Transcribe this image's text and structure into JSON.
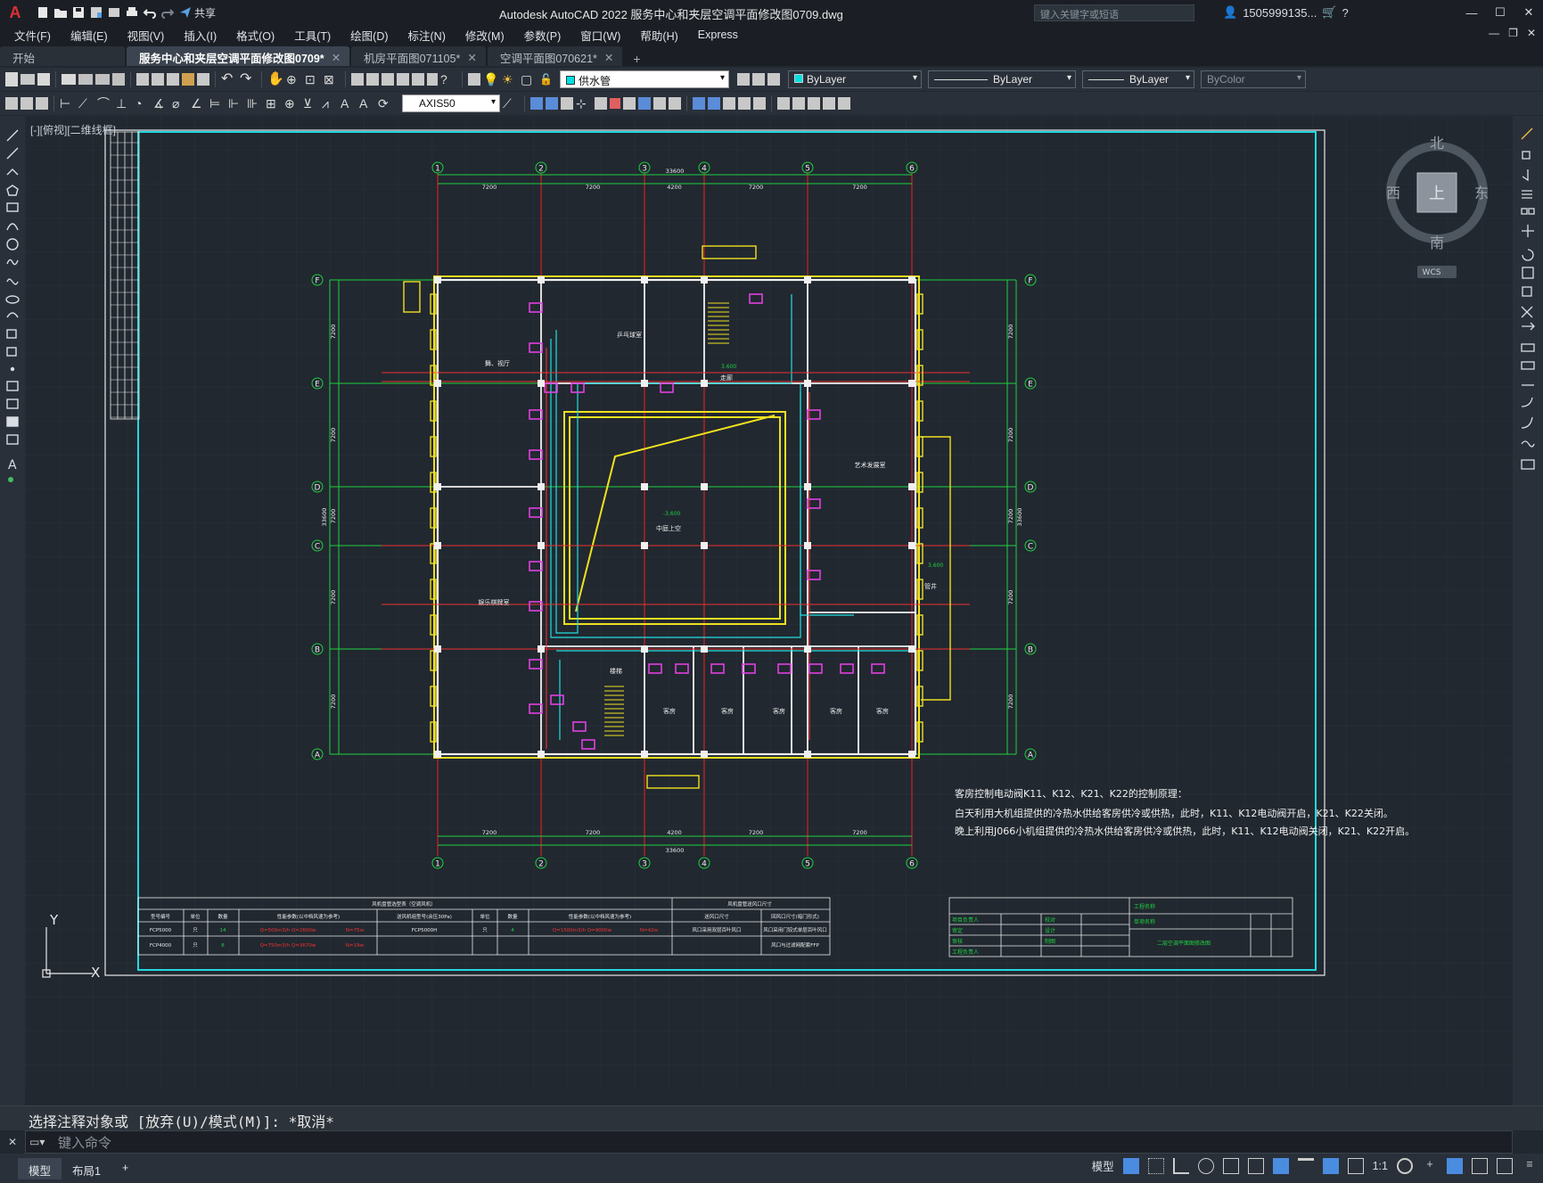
{
  "app": {
    "logo": "A",
    "title": "Autodesk AutoCAD 2022    服务中心和夹层空调平面修改图0709.dwg",
    "share": "共享",
    "search_placeholder": "键入关键字或短语",
    "user": "1505999135...",
    "window_controls": [
      "—",
      "☐",
      "✕"
    ]
  },
  "menu": [
    "文件(F)",
    "编辑(E)",
    "视图(V)",
    "插入(I)",
    "格式(O)",
    "工具(T)",
    "绘图(D)",
    "标注(N)",
    "修改(M)",
    "参数(P)",
    "窗口(W)",
    "帮助(H)",
    "Express"
  ],
  "mdi_controls": [
    "—",
    "❐",
    "✕"
  ],
  "tabs": [
    {
      "label": "开始",
      "active": false,
      "close": ""
    },
    {
      "label": "服务中心和夹层空调平面修改图0709*",
      "active": true,
      "close": "✕"
    },
    {
      "label": "机房平面图071105*",
      "active": false,
      "close": "✕"
    },
    {
      "label": "空调平面图070621*",
      "active": false,
      "close": "✕"
    }
  ],
  "tab_add": "+",
  "toolbar": {
    "layer": "供水管",
    "color": "ByLayer",
    "linetype": "ByLayer",
    "lineweight": "ByLayer",
    "plotstyle": "ByColor",
    "dimstyle": "AXIS50"
  },
  "viewport_label": "[-][俯视][二维线框]",
  "viewcube": {
    "north": "北",
    "south": "南",
    "east": "东",
    "west": "西",
    "top": "上",
    "wcs": "WCS"
  },
  "drawing": {
    "grid_cols": [
      "1",
      "2",
      "3",
      "4",
      "5",
      "6"
    ],
    "grid_rows": [
      "F",
      "E",
      "D",
      "C",
      "B",
      "A"
    ],
    "col_dims": [
      "7200",
      "7200",
      "4200",
      "7200",
      "7200"
    ],
    "total_width": "33600",
    "row_dims": [
      "7200",
      "7200",
      "7200",
      "7200",
      "7200"
    ],
    "total_height": "33600",
    "rooms": [
      "乒乓球室",
      "舞、视厅",
      "艺术发展室",
      "娱乐棋牌室",
      "中庭上空",
      "客房",
      "客房",
      "客房",
      "客房",
      "客房",
      "楼梯",
      "走廊",
      "管井"
    ],
    "elev_labels": [
      "-3.600",
      "3.600",
      "3.600"
    ],
    "notes": [
      "客房控制电动阀K11、K12、K21、K22的控制原理：",
      "白天利用大机组提供的冷热水供给客房供冷或供热，此时，K11、K12电动阀开启，K21、K22关闭。",
      "晚上利用J066小机组提供的冷热水供给客房供冷或供热，此时，K11、K12电动阀关闭，K21、K22开启。"
    ],
    "table": {
      "title1": "风机盘管选型表（空调风机）",
      "title2": "风机盘管送风口尺寸",
      "headers": [
        "型号编号",
        "单位",
        "数量",
        "性能参数(以中档风速为参考)",
        "",
        "送风机组型号(余压30Pa)",
        "单位",
        "数量",
        "性能参数(以中档风速为参考)",
        "",
        "送风口尺寸",
        "回风口尺寸(暗门形式)"
      ],
      "rows": [
        [
          "FCP5000",
          "只",
          "14",
          "Q=500m3/h Q=2600w",
          "N=75w",
          "FCP5000H",
          "只",
          "4",
          "Q=1500m3/h Q=9000w",
          "N=42w",
          "风口采用双层百叶风口",
          "风口采用门铰式单层百叶风口"
        ],
        [
          "FCP4000",
          "只",
          "8",
          "Q=750m3/h Q=3670w",
          "N=19w",
          "",
          "",
          "",
          "",
          "",
          "",
          "风口与过滤网配套FFP"
        ]
      ]
    },
    "titleblock": {
      "project": "工程名称",
      "item": "单项名称",
      "drawing_name": "二层空调平面图修改图",
      "roles": [
        "项目负责人",
        "审定",
        "审核",
        "工程负责人",
        "校对",
        "设计",
        "制图"
      ]
    }
  },
  "ucs": {
    "y": "Y",
    "x": "X"
  },
  "command": {
    "history": "选择注释对象或 [放弃(U)/模式(M)]: *取消*",
    "placeholder": "键入命令"
  },
  "layout_tabs": [
    "模型",
    "布局1",
    "+"
  ],
  "status": {
    "model": "模型",
    "scale": "1:1"
  }
}
